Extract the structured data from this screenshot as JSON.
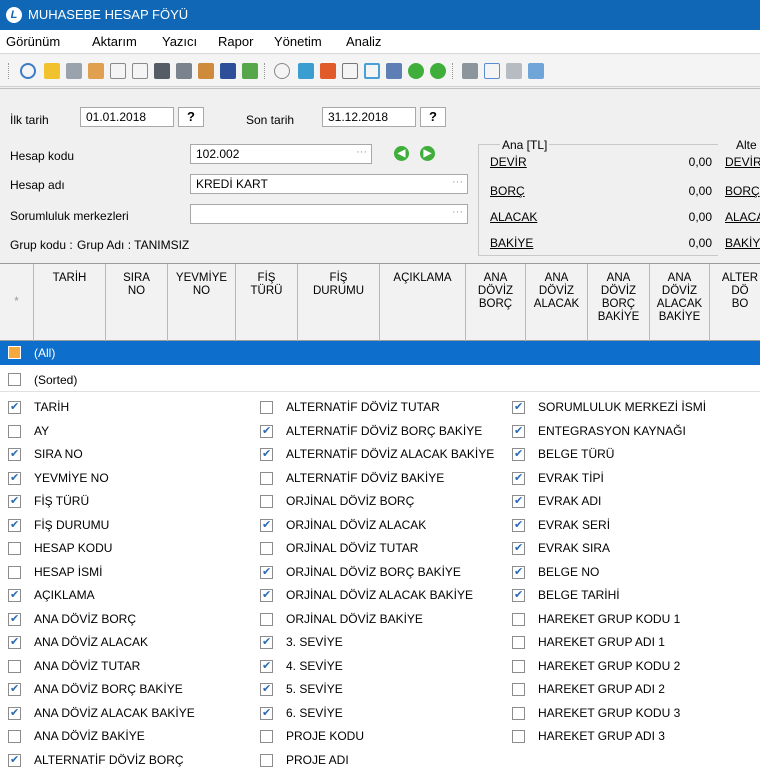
{
  "window": {
    "title": "MUHASEBE HESAP FÖYÜ"
  },
  "menu": [
    "Görünüm",
    "Aktarım",
    "Yazıcı",
    "Rapor",
    "Yönetim",
    "Analiz"
  ],
  "filters": {
    "start_label": "İlk tarih",
    "start_value": "01.01.2018",
    "start_btn": "?",
    "end_label": "Son tarih",
    "end_value": "31.12.2018",
    "end_btn": "?",
    "account_code_label": "Hesap kodu",
    "account_code_value": "102.002",
    "account_name_label": "Hesap adı",
    "account_name_value": "KREDİ KART",
    "responsibility_label": "Sorumluluk merkezleri",
    "responsibility_value": "",
    "group_code_label": "Grup kodu :",
    "group_name_label": "Grup Adı : TANIMSIZ"
  },
  "summary": {
    "main_header": "Ana [TL]",
    "alt_header": "Alte",
    "rows": [
      {
        "label": "DEVİR",
        "value": "0,00",
        "alt_label": "DEVİR"
      },
      {
        "label": "BORÇ",
        "value": "0,00",
        "alt_label": "BORÇ"
      },
      {
        "label": "ALACAK",
        "value": "0,00",
        "alt_label": "ALACA"
      },
      {
        "label": "BAKİYE",
        "value": "0,00",
        "alt_label": "BAKİY"
      }
    ]
  },
  "grid": {
    "star": "*",
    "columns": [
      "TARİH",
      "SIRA\nNO",
      "YEVMİYE\nNO",
      "FİŞ\nTÜRÜ",
      "FİŞ\nDURUMU",
      "AÇIKLAMA",
      "ANA\nDÖVİZ\nBORÇ",
      "ANA\nDÖVİZ\nALACAK",
      "ANA\nDÖVİZ\nBORÇ\nBAKİYE",
      "ANA\nDÖVİZ\nALACAK\nBAKİYE",
      "ALTER\nDÖ\nBO"
    ]
  },
  "column_filter": {
    "all_label": "(All)",
    "sorted_label": "(Sorted)",
    "items": [
      [
        {
          "label": "TARİH",
          "checked": true
        },
        {
          "label": "AY",
          "checked": false
        },
        {
          "label": "SIRA NO",
          "checked": true
        },
        {
          "label": "YEVMİYE NO",
          "checked": true
        },
        {
          "label": "FİŞ TÜRÜ",
          "checked": true
        },
        {
          "label": "FİŞ DURUMU",
          "checked": true
        },
        {
          "label": "HESAP KODU",
          "checked": false
        },
        {
          "label": "HESAP İSMİ",
          "checked": false
        },
        {
          "label": "AÇIKLAMA",
          "checked": true
        },
        {
          "label": "ANA DÖVİZ BORÇ",
          "checked": true
        },
        {
          "label": "ANA DÖVİZ ALACAK",
          "checked": true
        },
        {
          "label": "ANA DÖVİZ TUTAR",
          "checked": false
        },
        {
          "label": "ANA DÖVİZ BORÇ BAKİYE",
          "checked": true
        },
        {
          "label": "ANA DÖVİZ ALACAK BAKİYE",
          "checked": true
        },
        {
          "label": "ANA DÖVİZ BAKİYE",
          "checked": false
        },
        {
          "label": "ALTERNATİF DÖVİZ BORÇ",
          "checked": true
        }
      ],
      [
        {
          "label": "ALTERNATİF DÖVİZ TUTAR",
          "checked": false
        },
        {
          "label": "ALTERNATİF DÖVİZ BORÇ BAKİYE",
          "checked": true
        },
        {
          "label": "ALTERNATİF DÖVİZ ALACAK BAKİYE",
          "checked": true
        },
        {
          "label": "ALTERNATİF DÖVİZ BAKİYE",
          "checked": false
        },
        {
          "label": "ORJİNAL DÖVİZ BORÇ",
          "checked": false
        },
        {
          "label": "ORJİNAL DÖVİZ ALACAK",
          "checked": true
        },
        {
          "label": "ORJİNAL DÖVİZ TUTAR",
          "checked": false
        },
        {
          "label": "ORJİNAL DÖVİZ BORÇ BAKİYE",
          "checked": true
        },
        {
          "label": "ORJİNAL DÖVİZ ALACAK BAKİYE",
          "checked": true
        },
        {
          "label": "ORJİNAL DÖVİZ BAKİYE",
          "checked": false
        },
        {
          "label": "3. SEVİYE",
          "checked": true
        },
        {
          "label": "4. SEVİYE",
          "checked": true
        },
        {
          "label": "5. SEVİYE",
          "checked": true
        },
        {
          "label": "6. SEVİYE",
          "checked": true
        },
        {
          "label": "PROJE KODU",
          "checked": false
        },
        {
          "label": "PROJE ADI",
          "checked": false
        }
      ],
      [
        {
          "label": "SORUMLULUK MERKEZİ İSMİ",
          "checked": true
        },
        {
          "label": "ENTEGRASYON KAYNAĞI",
          "checked": true
        },
        {
          "label": "BELGE TÜRÜ",
          "checked": true
        },
        {
          "label": "EVRAK TİPİ",
          "checked": true
        },
        {
          "label": "EVRAK ADI",
          "checked": true
        },
        {
          "label": "EVRAK SERİ",
          "checked": true
        },
        {
          "label": "EVRAK SIRA",
          "checked": true
        },
        {
          "label": "BELGE NO",
          "checked": true
        },
        {
          "label": "BELGE TARİHİ",
          "checked": true
        },
        {
          "label": "HAREKET GRUP KODU 1",
          "checked": false
        },
        {
          "label": "HAREKET GRUP ADI 1",
          "checked": false
        },
        {
          "label": "HAREKET GRUP KODU 2",
          "checked": false
        },
        {
          "label": "HAREKET GRUP ADI 2",
          "checked": false
        },
        {
          "label": "HAREKET GRUP KODU 3",
          "checked": false
        },
        {
          "label": "HAREKET GRUP ADI 3",
          "checked": false
        }
      ]
    ]
  },
  "icons": [
    "refresh-icon",
    "pin-icon",
    "stop-icon",
    "grid-icon",
    "tree-icon",
    "columns-icon",
    "flag-dark-icon",
    "flag-icon",
    "table-icon",
    "save-icon",
    "tool-icon",
    "filter-icon",
    "view-icon",
    "calendar-icon",
    "sheet-icon",
    "edit-icon",
    "pencil-icon",
    "prev-icon",
    "next-icon",
    "print-icon",
    "preview-icon",
    "export-icon",
    "exit-icon"
  ]
}
